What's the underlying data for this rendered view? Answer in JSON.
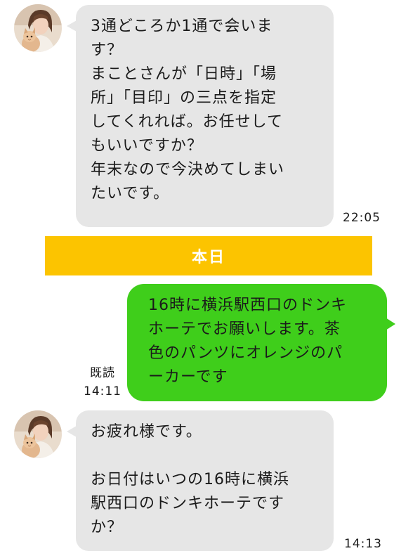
{
  "colors": {
    "incoming_bubble": "#e6e6e6",
    "outgoing_bubble": "#3fce1b",
    "date_separator": "#fcc400",
    "background": "#ffffff"
  },
  "messages": [
    {
      "direction": "incoming",
      "avatar_icon": "woman-with-cat-avatar",
      "text": "3通どころか1通で会いま\nす？\nまことさんが「日時」「場\n所」「目印」の三点を指定\nしてくれれば。お任せして\nもいいですか？\n年末なので今決めてしまい\nたいです。",
      "time": "22:05"
    },
    {
      "direction": "outgoing",
      "text": "16時に横浜駅西口のドンキ\nホーテでお願いします。茶\n色のパンツにオレンジのパ\nーカーです",
      "read_label": "既読",
      "time": "14:11"
    },
    {
      "direction": "incoming",
      "avatar_icon": "woman-with-cat-avatar",
      "text": "お疲れ様です。\n\nお日付はいつの16時に横浜\n駅西口のドンキホーテです\nか？",
      "time": "14:13"
    }
  ],
  "date_separator": {
    "label": "本日"
  }
}
